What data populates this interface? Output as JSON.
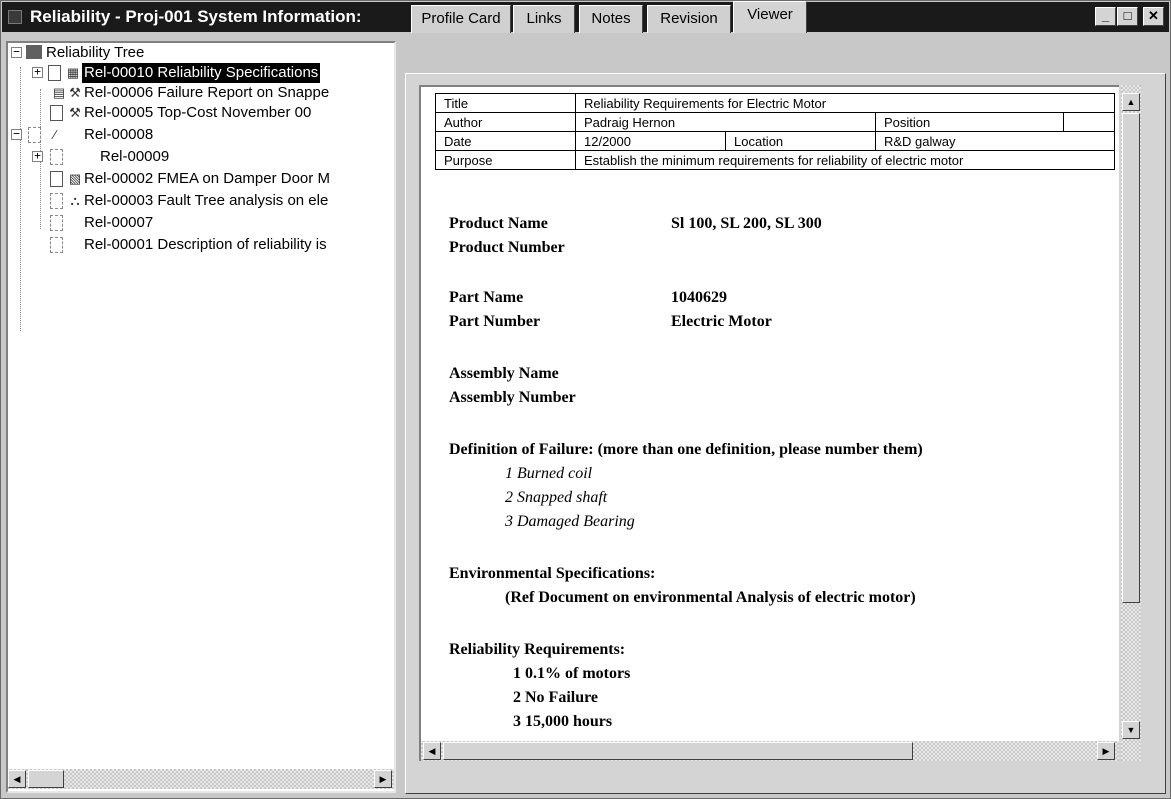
{
  "window": {
    "title": "Reliability - Proj-001 System Information:",
    "controls": [
      "minimize",
      "maximize",
      "close"
    ]
  },
  "tree": {
    "root_label": "Reliability Tree",
    "items": [
      {
        "label": "Rel-00010 Reliability Specifications",
        "selected": true,
        "icon": "spec-doc-icon"
      },
      {
        "label": "Rel-00006 Failure Report on Snappe",
        "icon": "failure-report-icon"
      },
      {
        "label": "Rel-00005 Top-Cost November 00",
        "icon": "failure-report-icon"
      },
      {
        "label": "Rel-00008",
        "icon": "chart-doc-icon"
      },
      {
        "label": "Rel-00009",
        "icon": "blank-doc-icon"
      },
      {
        "label": "Rel-00002 FMEA on Damper Door M",
        "icon": "fmea-doc-icon"
      },
      {
        "label": "Rel-00003 Fault Tree analysis on ele",
        "icon": "fault-tree-icon"
      },
      {
        "label": "Rel-00007",
        "icon": "blank-doc-icon"
      },
      {
        "label": "Rel-00001 Description of reliability is",
        "icon": "blank-doc-icon"
      }
    ]
  },
  "tabs": [
    "Profile Card",
    "Links",
    "Notes",
    "Revision",
    "Viewer"
  ],
  "active_tab": "Viewer",
  "info_table": {
    "title_label": "Title",
    "title_value": "Reliability Requirements for Electric Motor",
    "author_label": "Author",
    "author_value": "Padraig Hernon",
    "position_label": "Position",
    "date_label": "Date",
    "date_value": "12/2000",
    "location_label": "Location",
    "location_value": "R&D galway",
    "purpose_label": "Purpose",
    "purpose_value": "Establish the minimum requirements for reliability of electric motor"
  },
  "document": {
    "product_name_label": "Product Name",
    "product_name_value": "Sl 100, SL 200, SL 300",
    "product_number_label": "Product Number",
    "part_name_label": "Part Name",
    "part_name_value": "1040629",
    "part_number_label": "Part Number",
    "part_number_value": "Electric Motor",
    "assembly_name_label": "Assembly Name",
    "assembly_number_label": "Assembly Number",
    "failure_heading": "Definition of Failure: (more than one definition, please number them)",
    "failure_items": [
      "1 Burned coil",
      "2 Snapped shaft",
      "3 Damaged Bearing"
    ],
    "env_heading": "Environmental Specifications:",
    "env_ref": "(Ref Document on environmental Analysis of electric motor)",
    "req_heading": "Reliability Requirements:",
    "req_items": [
      "1 0.1% of motors",
      "2 No Failure",
      "3 15,000 hours"
    ]
  }
}
